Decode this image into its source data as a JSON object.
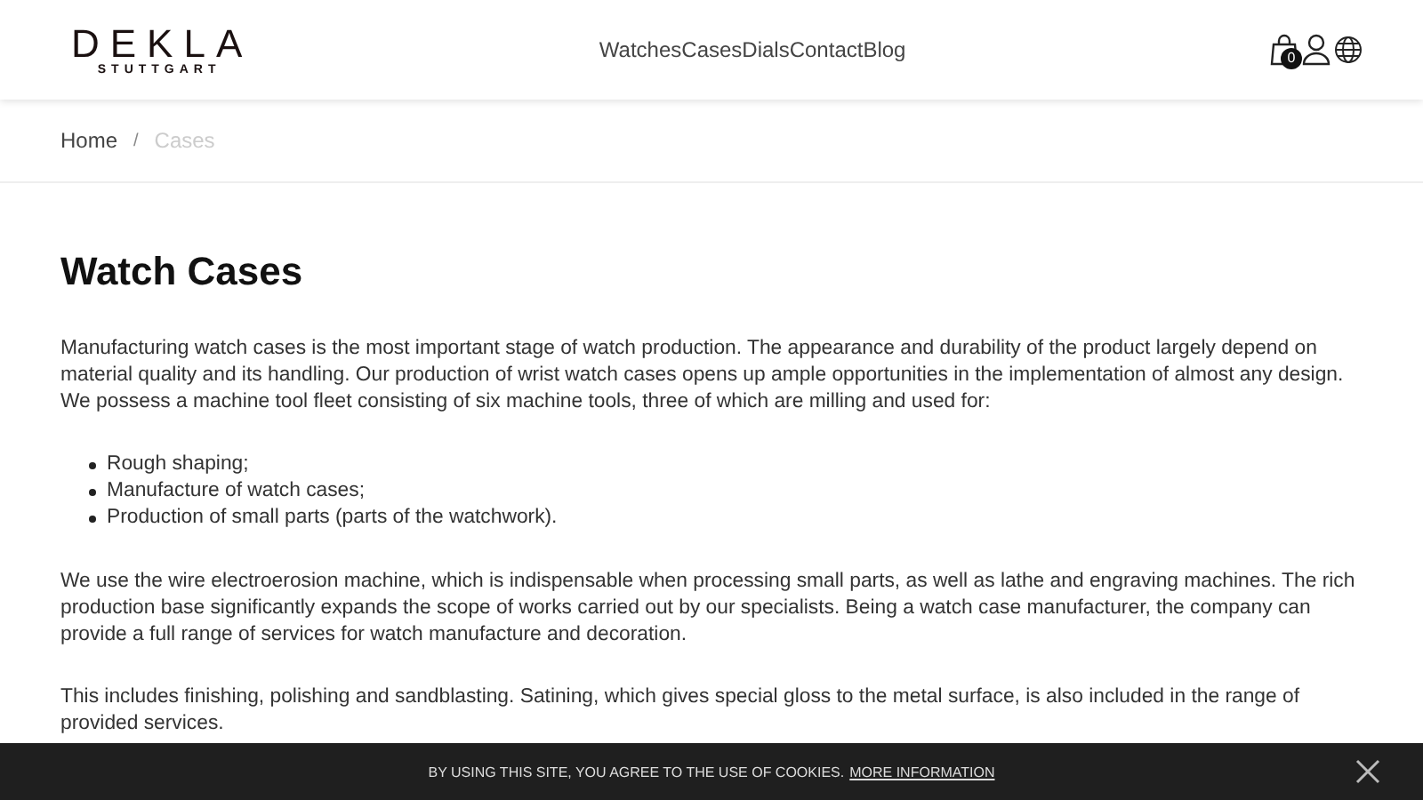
{
  "header": {
    "logo": {
      "name": "DEKLA",
      "city": "STUTTGART"
    },
    "nav": [
      {
        "label": "Watches",
        "selected": false
      },
      {
        "label": "Cases",
        "selected": false
      },
      {
        "label": "Dials",
        "selected": false
      },
      {
        "label": "Contact",
        "selected": false
      },
      {
        "label": "Blog",
        "selected": false
      }
    ],
    "cart_count": "0"
  },
  "breadcrumb": [
    {
      "label": "Home",
      "current": false
    },
    {
      "label": "Cases",
      "current": true
    }
  ],
  "breadcrumb_separator": "/",
  "title": "Watch Cases",
  "content": [
    {
      "kind": "paragraph",
      "text": "Manufacturing watch cases is the most important stage of watch production. The appearance and durability of the product largely depend on material quality and its handling. Our production of wrist watch cases opens up ample opportunities in the implementation of almost any design. We possess a machine tool fleet consisting of six machine tools, three of which are milling and used for:"
    },
    {
      "kind": "list",
      "items": [
        "Rough shaping;",
        "Manufacture of watch cases;",
        "Production of small parts (parts of the watchwork)."
      ]
    },
    {
      "kind": "paragraph",
      "text": "We use the wire electroerosion machine, which is indispensable when processing small parts, as well as lathe and engraving machines. The rich production base significantly expands the scope of works carried out by our specialists. Being a watch case manufacturer, the company can provide a full range of services for watch manufacture and decoration."
    },
    {
      "kind": "paragraph",
      "text": "This includes finishing, polishing and sandblasting. Satining, which gives special gloss to the metal surface, is also included in the range of provided services."
    }
  ],
  "cookie_banner": {
    "text": "BY USING THIS SITE, YOU AGREE TO THE USE OF COOKIES.",
    "link": "MORE INFORMATION"
  }
}
